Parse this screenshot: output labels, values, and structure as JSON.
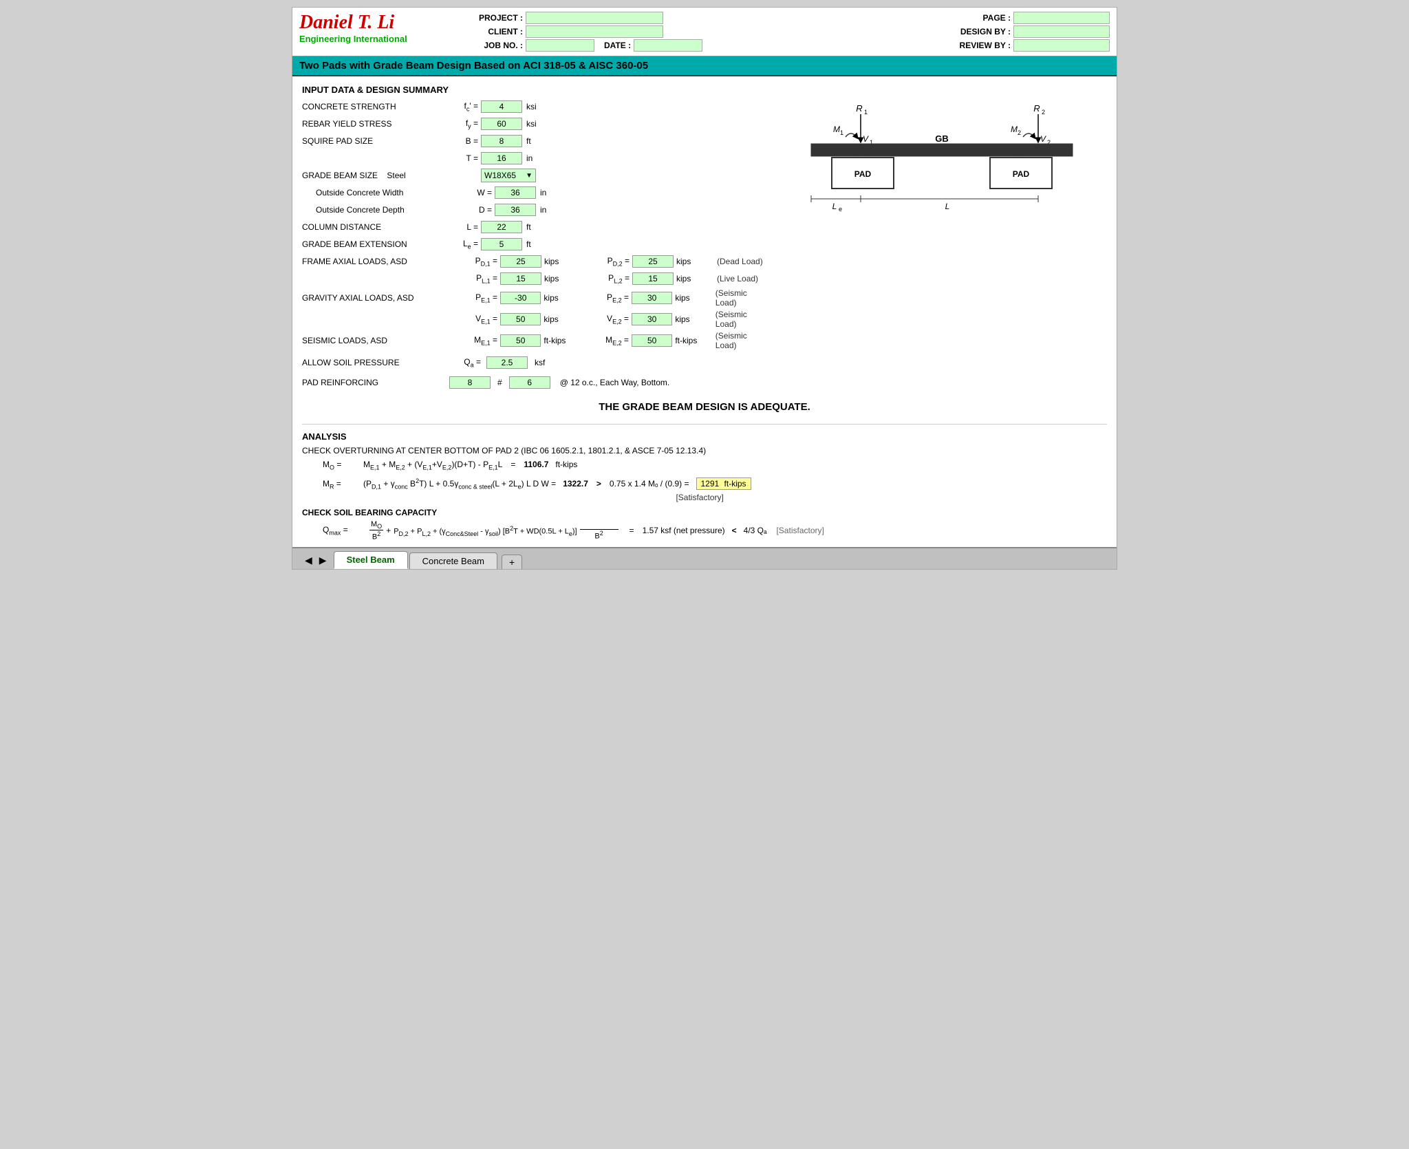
{
  "header": {
    "logo_title": "Daniel T. Li",
    "logo_sub": "Engineering International",
    "project_label": "PROJECT :",
    "client_label": "CLIENT :",
    "jobno_label": "JOB NO. :",
    "date_label": "DATE :",
    "page_label": "PAGE :",
    "designby_label": "DESIGN BY :",
    "reviewby_label": "REVIEW BY :"
  },
  "title": "Two Pads with Grade Beam Design Based on ACI 318-05 & AISC 360-05",
  "sections": {
    "input_title": "INPUT DATA & DESIGN SUMMARY",
    "concrete_strength": "CONCRETE STRENGTH",
    "concrete_fc_var": "fₙ' =",
    "concrete_fc_val": "4",
    "concrete_fc_unit": "ksi",
    "rebar_yield": "REBAR YIELD STRESS",
    "rebar_fy_var": "fʸ =",
    "rebar_fy_val": "60",
    "rebar_fy_unit": "ksi",
    "squire_pad": "SQUIRE PAD SIZE",
    "pad_B_var": "B =",
    "pad_B_val": "8",
    "pad_B_unit": "ft",
    "pad_T_var": "T =",
    "pad_T_val": "16",
    "pad_T_unit": "in",
    "grade_beam_size": "GRADE BEAM SIZE",
    "grade_beam_steel_label": "Steel",
    "grade_beam_dropdown": "W18X65",
    "outside_concrete_width_label": "Outside Concrete Width",
    "W_var": "W =",
    "W_val": "36",
    "W_unit": "in",
    "outside_concrete_depth_label": "Outside Concrete Depth",
    "D_var": "D =",
    "D_val": "36",
    "D_unit": "in",
    "column_distance": "COLUMN DISTANCE",
    "L_var": "L =",
    "L_val": "22",
    "L_unit": "ft",
    "grade_beam_extension": "GRADE BEAM EXTENSION",
    "Le_var": "Lₑ =",
    "Le_val": "5",
    "Le_unit": "ft",
    "frame_axial": "FRAME AXIAL LOADS, ASD",
    "PD1_var": "Pᴅ,₁ =",
    "PD1_val": "25",
    "PD1_unit": "kips",
    "PD2_var": "Pᴅ,₂ =",
    "PD2_val": "25",
    "PD2_unit": "kips",
    "PD_desc": "(Dead Load)",
    "PL1_var": "Pₗ,₁ =",
    "PL1_val": "15",
    "PL1_unit": "kips",
    "PL2_var": "Pₗ,₂ =",
    "PL2_val": "15",
    "PL2_unit": "kips",
    "PL_desc": "(Live Load)",
    "gravity_axial": "GRAVITY AXIAL LOADS, ASD",
    "PE1_var": "Pᴇ,₁ =",
    "PE1_val": "-30",
    "PE1_unit": "kips",
    "PE2_var": "Pᴇ,₂ =",
    "PE2_val": "30",
    "PE2_unit": "kips",
    "PE_desc": "(Seismic Load)",
    "VE1_var": "Vᴇ,₁ =",
    "VE1_val": "50",
    "VE1_unit": "kips",
    "VE2_var": "Vᴇ,₂ =",
    "VE2_val": "30",
    "VE2_unit": "kips",
    "VE_desc": "(Seismic Load)",
    "seismic_label": "SEISMIC LOADS, ASD",
    "ME1_var": "Mᴇ,₁ =",
    "ME1_val": "50",
    "ME1_unit": "ft-kips",
    "ME2_var": "Mᴇ,₂ =",
    "ME2_val": "50",
    "ME2_unit": "ft-kips",
    "ME_desc": "(Seismic Load)",
    "soil_pressure": "ALLOW SOIL PRESSURE",
    "Qa_var": "Qₐ =",
    "Qa_val": "2.5",
    "Qa_unit": "ksf",
    "pad_reinforcing": "PAD REINFORCING",
    "reinf_bars": "8",
    "reinf_hash": "#",
    "reinf_size": "6",
    "reinf_spacing": "@ 12 o.c., Each Way, Bottom.",
    "summary_text": "THE GRADE BEAM DESIGN IS ADEQUATE.",
    "analysis_title": "ANALYSIS",
    "check_overturning": "CHECK OVERTURNING AT CENTER BOTTOM OF PAD 2 (IBC 06 1605.2.1, 1801.2.1, & ASCE 7-05 12.13.4)",
    "MO_label": "Mₒ =",
    "MO_eq": "Mᴇ,₁ + Mᴇ,₂ + (Vᴇ,₁+Vᴇ,₂)(D+T) - Pᴇ,₁L",
    "MO_eq_equals": "=",
    "MO_val": "1106.7",
    "MO_unit": "ft-kips",
    "MR_label": "Mᴿ =",
    "MR_eq": "(Pᴅ,₁ + γᶜᵒⁿᶜ B²T) L + 0.5γᶜᵒⁿᶜ Ἀ ˢἈᵉᵏ(L + 2Lₑ) L D W =",
    "MR_val": "1322.7",
    "MR_gt": ">",
    "MR_check": "0.75 x 1.4 Mₒ / (0.9) =",
    "MR_result": "1291",
    "MR_result_unit": "ft-kips",
    "MR_satisfactory": "[Satisfactory]",
    "check_soil": "CHECK SOIL BEARING CAPACITY",
    "soil_eq_lhs": "Qₕₐˣ =",
    "soil_eq_frac_num": "Mₒ",
    "soil_eq_plus": "+ Pᴅ,₂ + Pₗ,₂ + (γᶜᵒⁿᶜ&ˢἈᵉᵏ - γˢᵒᴵˡ) [ B²T + WD(0.5L + Lₑ) ]",
    "soil_eq_frac_den": "B²",
    "soil_result": "1.57 ksf (net pressure)",
    "soil_lt": "<",
    "soil_qa": "4/3 Qₐ",
    "soil_satisfactory": "[Satisfactory]"
  },
  "tabs": [
    {
      "label": "Steel Beam",
      "active": true
    },
    {
      "label": "Concrete Beam",
      "active": false
    }
  ],
  "tab_add": "+",
  "colors": {
    "teal_header": "#00bbbb",
    "green_input": "#ccffcc",
    "blue_highlight": "#99ccff",
    "yellow_result": "#ffff99"
  }
}
